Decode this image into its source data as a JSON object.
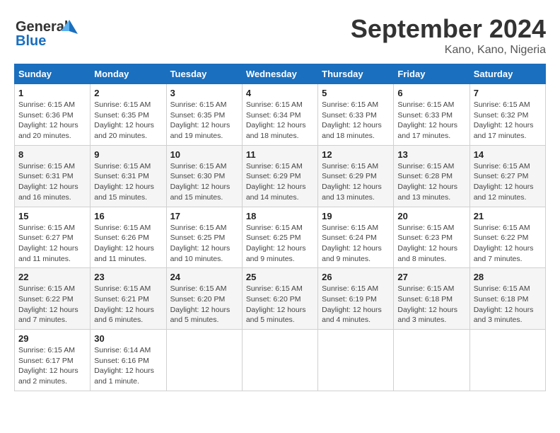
{
  "logo": {
    "line1": "General",
    "line2": "Blue"
  },
  "title": "September 2024",
  "location": "Kano, Kano, Nigeria",
  "days_of_week": [
    "Sunday",
    "Monday",
    "Tuesday",
    "Wednesday",
    "Thursday",
    "Friday",
    "Saturday"
  ],
  "weeks": [
    [
      {
        "day": "1",
        "sunrise": "6:15 AM",
        "sunset": "6:36 PM",
        "daylight": "12 hours and 20 minutes."
      },
      {
        "day": "2",
        "sunrise": "6:15 AM",
        "sunset": "6:35 PM",
        "daylight": "12 hours and 20 minutes."
      },
      {
        "day": "3",
        "sunrise": "6:15 AM",
        "sunset": "6:35 PM",
        "daylight": "12 hours and 19 minutes."
      },
      {
        "day": "4",
        "sunrise": "6:15 AM",
        "sunset": "6:34 PM",
        "daylight": "12 hours and 18 minutes."
      },
      {
        "day": "5",
        "sunrise": "6:15 AM",
        "sunset": "6:33 PM",
        "daylight": "12 hours and 18 minutes."
      },
      {
        "day": "6",
        "sunrise": "6:15 AM",
        "sunset": "6:33 PM",
        "daylight": "12 hours and 17 minutes."
      },
      {
        "day": "7",
        "sunrise": "6:15 AM",
        "sunset": "6:32 PM",
        "daylight": "12 hours and 17 minutes."
      }
    ],
    [
      {
        "day": "8",
        "sunrise": "6:15 AM",
        "sunset": "6:31 PM",
        "daylight": "12 hours and 16 minutes."
      },
      {
        "day": "9",
        "sunrise": "6:15 AM",
        "sunset": "6:31 PM",
        "daylight": "12 hours and 15 minutes."
      },
      {
        "day": "10",
        "sunrise": "6:15 AM",
        "sunset": "6:30 PM",
        "daylight": "12 hours and 15 minutes."
      },
      {
        "day": "11",
        "sunrise": "6:15 AM",
        "sunset": "6:29 PM",
        "daylight": "12 hours and 14 minutes."
      },
      {
        "day": "12",
        "sunrise": "6:15 AM",
        "sunset": "6:29 PM",
        "daylight": "12 hours and 13 minutes."
      },
      {
        "day": "13",
        "sunrise": "6:15 AM",
        "sunset": "6:28 PM",
        "daylight": "12 hours and 13 minutes."
      },
      {
        "day": "14",
        "sunrise": "6:15 AM",
        "sunset": "6:27 PM",
        "daylight": "12 hours and 12 minutes."
      }
    ],
    [
      {
        "day": "15",
        "sunrise": "6:15 AM",
        "sunset": "6:27 PM",
        "daylight": "12 hours and 11 minutes."
      },
      {
        "day": "16",
        "sunrise": "6:15 AM",
        "sunset": "6:26 PM",
        "daylight": "12 hours and 11 minutes."
      },
      {
        "day": "17",
        "sunrise": "6:15 AM",
        "sunset": "6:25 PM",
        "daylight": "12 hours and 10 minutes."
      },
      {
        "day": "18",
        "sunrise": "6:15 AM",
        "sunset": "6:25 PM",
        "daylight": "12 hours and 9 minutes."
      },
      {
        "day": "19",
        "sunrise": "6:15 AM",
        "sunset": "6:24 PM",
        "daylight": "12 hours and 9 minutes."
      },
      {
        "day": "20",
        "sunrise": "6:15 AM",
        "sunset": "6:23 PM",
        "daylight": "12 hours and 8 minutes."
      },
      {
        "day": "21",
        "sunrise": "6:15 AM",
        "sunset": "6:22 PM",
        "daylight": "12 hours and 7 minutes."
      }
    ],
    [
      {
        "day": "22",
        "sunrise": "6:15 AM",
        "sunset": "6:22 PM",
        "daylight": "12 hours and 7 minutes."
      },
      {
        "day": "23",
        "sunrise": "6:15 AM",
        "sunset": "6:21 PM",
        "daylight": "12 hours and 6 minutes."
      },
      {
        "day": "24",
        "sunrise": "6:15 AM",
        "sunset": "6:20 PM",
        "daylight": "12 hours and 5 minutes."
      },
      {
        "day": "25",
        "sunrise": "6:15 AM",
        "sunset": "6:20 PM",
        "daylight": "12 hours and 5 minutes."
      },
      {
        "day": "26",
        "sunrise": "6:15 AM",
        "sunset": "6:19 PM",
        "daylight": "12 hours and 4 minutes."
      },
      {
        "day": "27",
        "sunrise": "6:15 AM",
        "sunset": "6:18 PM",
        "daylight": "12 hours and 3 minutes."
      },
      {
        "day": "28",
        "sunrise": "6:15 AM",
        "sunset": "6:18 PM",
        "daylight": "12 hours and 3 minutes."
      }
    ],
    [
      {
        "day": "29",
        "sunrise": "6:15 AM",
        "sunset": "6:17 PM",
        "daylight": "12 hours and 2 minutes."
      },
      {
        "day": "30",
        "sunrise": "6:14 AM",
        "sunset": "6:16 PM",
        "daylight": "12 hours and 1 minute."
      },
      null,
      null,
      null,
      null,
      null
    ]
  ]
}
